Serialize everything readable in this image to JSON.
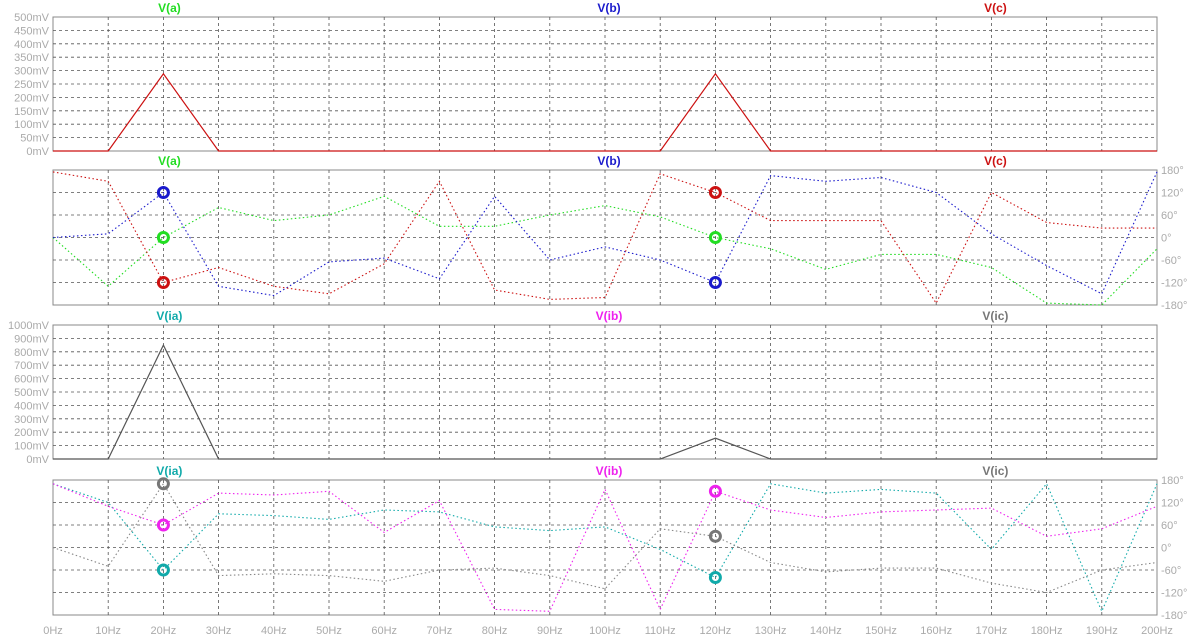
{
  "window": {
    "background": "#ffffff"
  },
  "x_axis": {
    "ticks": [
      0,
      10,
      20,
      30,
      40,
      50,
      60,
      70,
      80,
      90,
      100,
      110,
      120,
      130,
      140,
      150,
      160,
      170,
      180,
      190,
      200
    ],
    "tick_labels": [
      "0Hz",
      "10Hz",
      "20Hz",
      "30Hz",
      "40Hz",
      "50Hz",
      "60Hz",
      "70Hz",
      "80Hz",
      "90Hz",
      "100Hz",
      "110Hz",
      "120Hz",
      "130Hz",
      "140Hz",
      "150Hz",
      "160Hz",
      "170Hz",
      "180Hz",
      "190Hz",
      "200Hz"
    ],
    "range": [
      0,
      200
    ]
  },
  "colors": {
    "a": "#22dd22",
    "b": "#1a1acc",
    "c": "#cc1111",
    "ia": "#11aaaa",
    "ib": "#ee22ee",
    "ic": "#777777",
    "grid": "#555555",
    "axis_text": "#aaaaaa",
    "border": "#888888"
  },
  "chart_data": [
    {
      "type": "line",
      "panel": "voltage-magnitude",
      "legend": [
        "V(a)",
        "V(b)",
        "V(c)"
      ],
      "legend_colors": [
        "#22dd22",
        "#1a1acc",
        "#cc1111"
      ],
      "yticks": [
        0,
        50,
        100,
        150,
        200,
        250,
        300,
        350,
        400,
        450,
        500
      ],
      "ytick_labels": [
        "0mV",
        "50mV",
        "100mV",
        "150mV",
        "200mV",
        "250mV",
        "300mV",
        "350mV",
        "400mV",
        "450mV",
        "500mV"
      ],
      "ylim": [
        0,
        500
      ],
      "ylabel_side": "left",
      "series": [
        {
          "color": "#cc1111",
          "style": "solid",
          "x": [
            0,
            10,
            20,
            30,
            40,
            50,
            60,
            70,
            80,
            90,
            100,
            110,
            120,
            130,
            140,
            150,
            160,
            170,
            180,
            190,
            200
          ],
          "values": [
            0,
            0,
            288,
            0,
            0,
            0,
            0,
            0,
            0,
            0,
            0,
            0,
            288,
            0,
            0,
            0,
            0,
            0,
            0,
            0,
            0
          ]
        }
      ],
      "markers": []
    },
    {
      "type": "line",
      "panel": "voltage-phase",
      "legend": [
        "V(a)",
        "V(b)",
        "V(c)"
      ],
      "legend_colors": [
        "#22dd22",
        "#1a1acc",
        "#cc1111"
      ],
      "yticks": [
        -180,
        -120,
        -60,
        0,
        60,
        120,
        180
      ],
      "ytick_labels": [
        "-180°",
        "-120°",
        "-60°",
        "0°",
        "60°",
        "120°",
        "180°"
      ],
      "ylim": [
        -180,
        180
      ],
      "ylabel_side": "right",
      "series": [
        {
          "color": "#22dd22",
          "style": "dotted",
          "x": [
            0,
            10,
            20,
            30,
            40,
            50,
            60,
            70,
            80,
            90,
            100,
            110,
            120,
            130,
            140,
            150,
            160,
            170,
            180,
            190,
            200
          ],
          "values": [
            0,
            -130,
            0,
            80,
            45,
            60,
            110,
            30,
            30,
            60,
            85,
            55,
            0,
            -30,
            -85,
            -45,
            -45,
            -80,
            -175,
            -180,
            -30
          ]
        },
        {
          "color": "#1a1acc",
          "style": "dotted",
          "x": [
            0,
            10,
            20,
            30,
            40,
            50,
            60,
            70,
            80,
            90,
            100,
            110,
            120,
            130,
            140,
            150,
            160,
            170,
            180,
            190,
            200
          ],
          "values": [
            0,
            10,
            120,
            -130,
            -155,
            -65,
            -55,
            -110,
            110,
            -60,
            -25,
            -60,
            -120,
            165,
            150,
            160,
            120,
            10,
            -75,
            -150,
            175
          ]
        },
        {
          "color": "#cc1111",
          "style": "dotted",
          "x": [
            0,
            10,
            20,
            30,
            40,
            50,
            60,
            70,
            80,
            90,
            100,
            110,
            120,
            130,
            140,
            150,
            160,
            170,
            180,
            190,
            200
          ],
          "values": [
            175,
            150,
            -120,
            -80,
            -130,
            -150,
            -70,
            150,
            -140,
            -165,
            -160,
            170,
            120,
            45,
            45,
            45,
            -175,
            120,
            40,
            25,
            25
          ]
        }
      ],
      "markers": [
        {
          "x": 20,
          "y": 120,
          "color": "#1a1acc"
        },
        {
          "x": 20,
          "y": 0,
          "color": "#22dd22"
        },
        {
          "x": 20,
          "y": -120,
          "color": "#cc1111"
        },
        {
          "x": 120,
          "y": 120,
          "color": "#cc1111"
        },
        {
          "x": 120,
          "y": 0,
          "color": "#22dd22"
        },
        {
          "x": 120,
          "y": -120,
          "color": "#1a1acc"
        }
      ]
    },
    {
      "type": "line",
      "panel": "current-magnitude",
      "legend": [
        "V(ia)",
        "V(ib)",
        "V(ic)"
      ],
      "legend_colors": [
        "#11aaaa",
        "#ee22ee",
        "#777777"
      ],
      "yticks": [
        0,
        100,
        200,
        300,
        400,
        500,
        600,
        700,
        800,
        900,
        1000
      ],
      "ytick_labels": [
        "0mV",
        "100mV",
        "200mV",
        "300mV",
        "400mV",
        "500mV",
        "600mV",
        "700mV",
        "800mV",
        "900mV",
        "1000mV"
      ],
      "ylim": [
        0,
        1000
      ],
      "ylabel_side": "left",
      "series": [
        {
          "color": "#555555",
          "style": "solid",
          "x": [
            0,
            10,
            20,
            30,
            40,
            50,
            60,
            70,
            80,
            90,
            100,
            110,
            120,
            130,
            140,
            150,
            160,
            170,
            180,
            190,
            200
          ],
          "values": [
            0,
            0,
            850,
            0,
            0,
            0,
            0,
            0,
            0,
            0,
            0,
            0,
            155,
            0,
            0,
            0,
            0,
            0,
            0,
            0,
            0
          ]
        }
      ],
      "markers": []
    },
    {
      "type": "line",
      "panel": "current-phase",
      "legend": [
        "V(ia)",
        "V(ib)",
        "V(ic)"
      ],
      "legend_colors": [
        "#11aaaa",
        "#ee22ee",
        "#777777"
      ],
      "yticks": [
        -180,
        -120,
        -60,
        0,
        60,
        120,
        180
      ],
      "ytick_labels": [
        "-180°",
        "-120°",
        "-60°",
        "0°",
        "60°",
        "120°",
        "180°"
      ],
      "ylim": [
        -180,
        180
      ],
      "ylabel_side": "right",
      "series": [
        {
          "color": "#11aaaa",
          "style": "dotted",
          "x": [
            0,
            10,
            20,
            30,
            40,
            50,
            60,
            70,
            80,
            90,
            100,
            110,
            120,
            130,
            140,
            150,
            160,
            170,
            180,
            190,
            200
          ],
          "values": [
            170,
            120,
            -60,
            90,
            85,
            75,
            100,
            95,
            55,
            45,
            55,
            -5,
            -80,
            170,
            145,
            155,
            145,
            -5,
            170,
            -170,
            170
          ]
        },
        {
          "color": "#ee22ee",
          "style": "dotted",
          "x": [
            0,
            10,
            20,
            30,
            40,
            50,
            60,
            70,
            80,
            90,
            100,
            110,
            120,
            130,
            140,
            150,
            160,
            170,
            180,
            190,
            200
          ],
          "values": [
            170,
            110,
            60,
            145,
            140,
            150,
            40,
            125,
            -165,
            -170,
            155,
            -165,
            150,
            100,
            80,
            95,
            100,
            105,
            30,
            50,
            110
          ]
        },
        {
          "color": "#888888",
          "style": "dotted",
          "x": [
            0,
            10,
            20,
            30,
            40,
            50,
            60,
            70,
            80,
            90,
            100,
            110,
            120,
            130,
            140,
            150,
            160,
            170,
            180,
            190,
            200
          ],
          "values": [
            0,
            -50,
            170,
            -75,
            -70,
            -75,
            -90,
            -60,
            -55,
            -75,
            -110,
            50,
            30,
            -40,
            -65,
            -55,
            -55,
            -95,
            -120,
            -60,
            -40
          ]
        }
      ],
      "markers": [
        {
          "x": 20,
          "y": 170,
          "color": "#777777"
        },
        {
          "x": 20,
          "y": 60,
          "color": "#ee22ee"
        },
        {
          "x": 20,
          "y": -60,
          "color": "#11aaaa"
        },
        {
          "x": 120,
          "y": 150,
          "color": "#ee22ee"
        },
        {
          "x": 120,
          "y": 30,
          "color": "#777777"
        },
        {
          "x": 120,
          "y": -80,
          "color": "#11aaaa"
        }
      ]
    }
  ]
}
